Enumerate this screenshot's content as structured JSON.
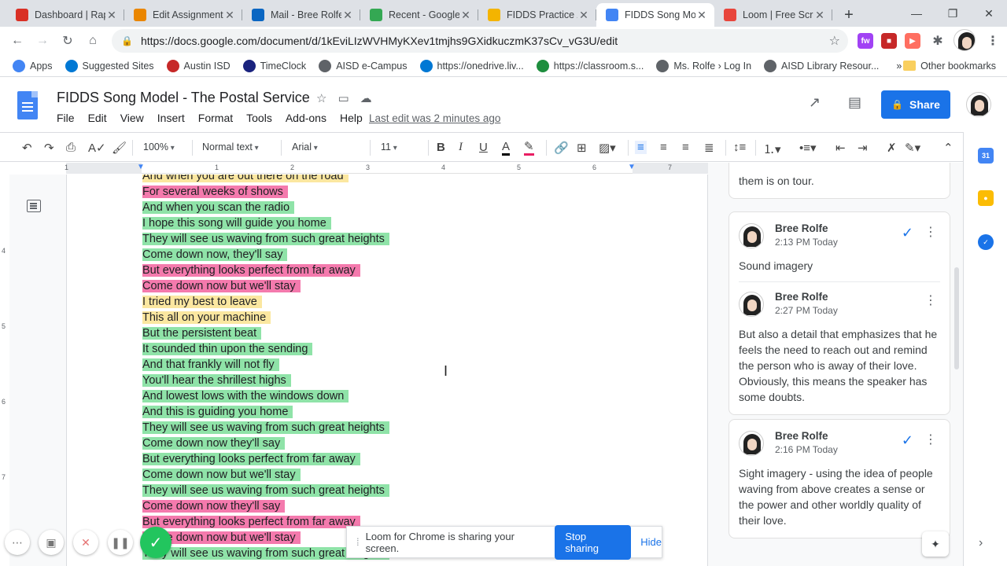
{
  "browser": {
    "tabs": [
      {
        "title": "Dashboard | Rap",
        "color": "#d93025",
        "active": false
      },
      {
        "title": "Edit Assignment",
        "color": "#ea8600",
        "active": false
      },
      {
        "title": "Mail - Bree Rolfe",
        "color": "#0a66c2",
        "active": false
      },
      {
        "title": "Recent - Google",
        "color": "#34a853",
        "active": false
      },
      {
        "title": "FIDDS Practice /",
        "color": "#f4b400",
        "active": false
      },
      {
        "title": "FIDDS Song Mo",
        "color": "#4285f4",
        "active": true
      },
      {
        "title": "Loom | Free Scr",
        "color": "#e8453c",
        "active": false
      }
    ],
    "new_tab": "+",
    "url": "https://docs.google.com/document/d/1kEviLIzWVHMyKXev1tmjhs9GXidkuczmK37sCv_vG3U/edit",
    "bookmarks": [
      {
        "label": "Apps",
        "color": "#4285f4"
      },
      {
        "label": "Suggested Sites",
        "color": "#0078d4"
      },
      {
        "label": "Austin ISD",
        "color": "#c62828"
      },
      {
        "label": "TimeClock",
        "color": "#1a237e"
      },
      {
        "label": "AISD e-Campus",
        "color": "#5f6368"
      },
      {
        "label": "https://onedrive.liv...",
        "color": "#0078d4"
      },
      {
        "label": "https://classroom.s...",
        "color": "#1e8e3e"
      },
      {
        "label": "Ms. Rolfe › Log In",
        "color": "#5f6368"
      },
      {
        "label": "AISD Library Resour...",
        "color": "#5f6368"
      }
    ],
    "bookmarks_more": "»",
    "other_bookmarks": "Other bookmarks"
  },
  "docs": {
    "title": "FIDDS Song Model - The Postal Service",
    "menu": [
      "File",
      "Edit",
      "View",
      "Insert",
      "Format",
      "Tools",
      "Add-ons",
      "Help"
    ],
    "last_edit": "Last edit was 2 minutes ago",
    "share_label": "Share",
    "toolbar": {
      "zoom": "100%",
      "style": "Normal text",
      "font": "Arial",
      "size": "11"
    },
    "ruler_numbers": [
      "1",
      "1",
      "2",
      "3",
      "4",
      "5",
      "6",
      "7"
    ],
    "vruler_numbers": [
      "4",
      "5",
      "6",
      "7"
    ]
  },
  "lyrics": [
    {
      "text": "And when you are out there on the road",
      "hl": "yellow"
    },
    {
      "text": "For several weeks of shows",
      "hl": "pink"
    },
    {
      "text": "And when you scan the radio",
      "hl": "green"
    },
    {
      "text": "I hope this song will guide you home",
      "hl": "green"
    },
    {
      "text": "They will see us waving from such great heights",
      "hl": "green"
    },
    {
      "text": "Come down now, they'll say",
      "hl": "green"
    },
    {
      "text": "But everything looks perfect from far away",
      "hl": "pink"
    },
    {
      "text": "Come down now but we'll stay",
      "hl": "pink"
    },
    {
      "text": "I tried my best to leave",
      "hl": "yellow"
    },
    {
      "text": "This all on your machine",
      "hl": "yellow"
    },
    {
      "text": "But the persistent beat",
      "hl": "green"
    },
    {
      "text": "It sounded thin upon the sending",
      "hl": "green"
    },
    {
      "text": "And that frankly will not fly",
      "hl": "green"
    },
    {
      "text": "You'll hear the shrillest highs",
      "hl": "green"
    },
    {
      "text": "And lowest lows with the windows down",
      "hl": "green"
    },
    {
      "text": "And this is guiding you home",
      "hl": "green"
    },
    {
      "text": "They will see us waving from such great heights",
      "hl": "green"
    },
    {
      "text": "Come down now they'll say",
      "hl": "green"
    },
    {
      "text": "But everything looks perfect from far away",
      "hl": "green"
    },
    {
      "text": "Come down now but we'll stay",
      "hl": "green"
    },
    {
      "text": "They will see us waving from such great heights",
      "hl": "green"
    },
    {
      "text": "Come down now they'll say",
      "hl": "pink"
    },
    {
      "text": "But everything looks perfect from far away",
      "hl": "pink"
    },
    {
      "text": "Come down now but we'll stay",
      "hl": "pink"
    },
    {
      "text": "They will see us waving from such great heights",
      "hl": "green"
    }
  ],
  "comments": {
    "top_fragment": "them is on tour.",
    "threads": [
      {
        "resolved_check": true,
        "entries": [
          {
            "name": "Bree Rolfe",
            "time": "2:13 PM Today",
            "body": "Sound imagery"
          },
          {
            "name": "Bree Rolfe",
            "time": "2:27 PM Today",
            "body": "But also a detail that emphasizes that he feels the need to reach out and remind the person who is away of their love. Obviously, this means the speaker has some doubts."
          }
        ]
      },
      {
        "resolved_check": true,
        "entries": [
          {
            "name": "Bree Rolfe",
            "time": "2:16 PM Today",
            "body": "Sight imagery - using the idea of people waving from above creates a sense or the power and other worldly quality of their love."
          }
        ]
      }
    ]
  },
  "loom": {
    "message": "Loom for Chrome is sharing your screen.",
    "stop_label": "Stop sharing",
    "hide_label": "Hide"
  },
  "colors": {
    "accent": "#1a73e8",
    "highlight_pink": "#f47aad",
    "highlight_green": "#8fe3a8",
    "highlight_yellow": "#fbe7a0"
  }
}
